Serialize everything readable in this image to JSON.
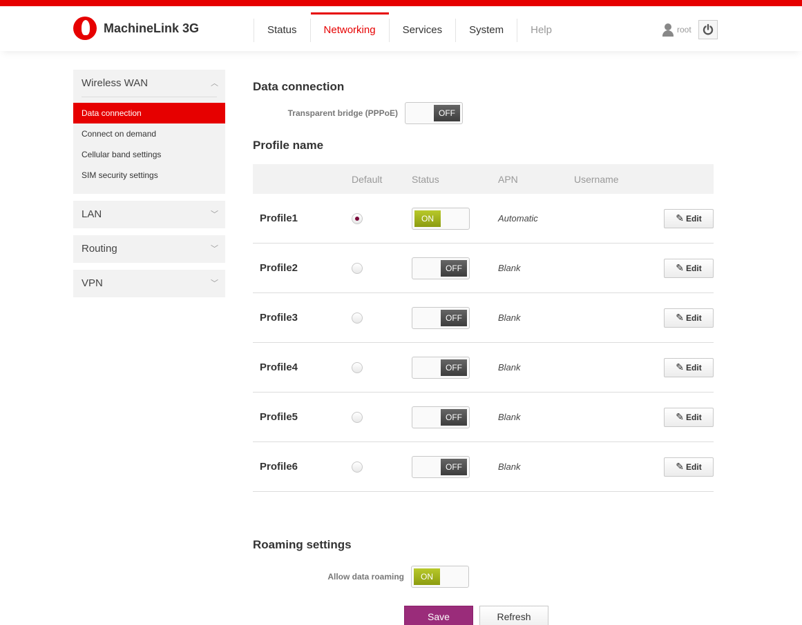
{
  "header": {
    "brand": "MachineLink 3G",
    "nav": [
      {
        "label": "Status"
      },
      {
        "label": "Networking"
      },
      {
        "label": "Services"
      },
      {
        "label": "System"
      },
      {
        "label": "Help"
      }
    ],
    "active_nav": "Networking",
    "user": "root",
    "icons": {
      "logo": "vodafone-logo",
      "user": "user-icon",
      "power": "power-icon"
    }
  },
  "sidebar": {
    "groups": [
      {
        "label": "Wireless WAN",
        "expanded": true,
        "items": [
          "Data connection",
          "Connect on demand",
          "Cellular band settings",
          "SIM security settings"
        ],
        "active_item": "Data connection"
      },
      {
        "label": "LAN",
        "expanded": false
      },
      {
        "label": "Routing",
        "expanded": false
      },
      {
        "label": "VPN",
        "expanded": false
      }
    ]
  },
  "data_connection": {
    "title": "Data connection",
    "bridge_label": "Transparent bridge (PPPoE)",
    "bridge_state": "OFF"
  },
  "profiles": {
    "title": "Profile name",
    "columns": [
      "Default",
      "Status",
      "APN",
      "Username"
    ],
    "rows": [
      {
        "name": "Profile1",
        "default": true,
        "status": "ON",
        "apn": "Automatic",
        "username": "",
        "edit": "Edit"
      },
      {
        "name": "Profile2",
        "default": false,
        "status": "OFF",
        "apn": "Blank",
        "username": "",
        "edit": "Edit"
      },
      {
        "name": "Profile3",
        "default": false,
        "status": "OFF",
        "apn": "Blank",
        "username": "",
        "edit": "Edit"
      },
      {
        "name": "Profile4",
        "default": false,
        "status": "OFF",
        "apn": "Blank",
        "username": "",
        "edit": "Edit"
      },
      {
        "name": "Profile5",
        "default": false,
        "status": "OFF",
        "apn": "Blank",
        "username": "",
        "edit": "Edit"
      },
      {
        "name": "Profile6",
        "default": false,
        "status": "OFF",
        "apn": "Blank",
        "username": "",
        "edit": "Edit"
      }
    ]
  },
  "roaming": {
    "title": "Roaming settings",
    "label": "Allow data roaming",
    "state": "ON"
  },
  "actions": {
    "save": "Save",
    "refresh": "Refresh"
  },
  "colors": {
    "brand_red": "#e60000",
    "toggle_on": "#9aab15",
    "save_button": "#9a2c7a"
  }
}
